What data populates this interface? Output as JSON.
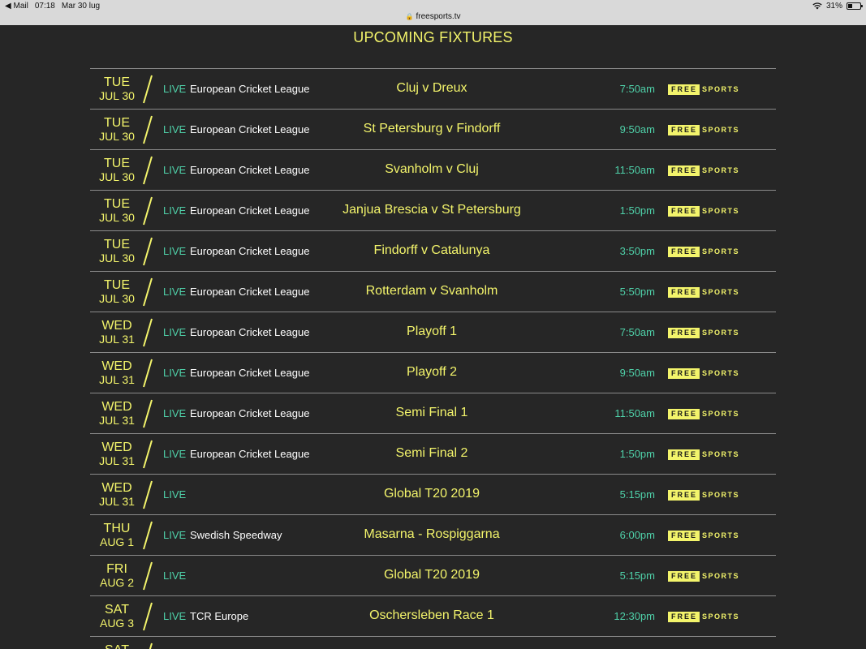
{
  "status_bar": {
    "back_app": "Mail",
    "time": "07:18",
    "date": "Mar 30 lug",
    "battery": "31%",
    "battery_level": 0.31,
    "url": "freesports.tv"
  },
  "page": {
    "title": "UPCOMING FIXTURES"
  },
  "fixtures": [
    {
      "day": "TUE",
      "date": "JUL 30",
      "live": "LIVE",
      "competition": "European Cricket League",
      "match": "Cluj v Dreux",
      "time": "7:50am",
      "channel_a": "FREE",
      "channel_b": "SPORTS"
    },
    {
      "day": "TUE",
      "date": "JUL 30",
      "live": "LIVE",
      "competition": "European Cricket League",
      "match": "St Petersburg v Findorff",
      "time": "9:50am",
      "channel_a": "FREE",
      "channel_b": "SPORTS"
    },
    {
      "day": "TUE",
      "date": "JUL 30",
      "live": "LIVE",
      "competition": "European Cricket League",
      "match": "Svanholm v Cluj",
      "time": "11:50am",
      "channel_a": "FREE",
      "channel_b": "SPORTS"
    },
    {
      "day": "TUE",
      "date": "JUL 30",
      "live": "LIVE",
      "competition": "European Cricket League",
      "match": "Janjua Brescia v St Petersburg",
      "time": "1:50pm",
      "channel_a": "FREE",
      "channel_b": "SPORTS"
    },
    {
      "day": "TUE",
      "date": "JUL 30",
      "live": "LIVE",
      "competition": "European Cricket League",
      "match": "Findorff v Catalunya",
      "time": "3:50pm",
      "channel_a": "FREE",
      "channel_b": "SPORTS"
    },
    {
      "day": "TUE",
      "date": "JUL 30",
      "live": "LIVE",
      "competition": "European Cricket League",
      "match": "Rotterdam v Svanholm",
      "time": "5:50pm",
      "channel_a": "FREE",
      "channel_b": "SPORTS"
    },
    {
      "day": "WED",
      "date": "JUL 31",
      "live": "LIVE",
      "competition": "European Cricket League",
      "match": "Playoff 1",
      "time": "7:50am",
      "channel_a": "FREE",
      "channel_b": "SPORTS"
    },
    {
      "day": "WED",
      "date": "JUL 31",
      "live": "LIVE",
      "competition": "European Cricket League",
      "match": "Playoff 2",
      "time": "9:50am",
      "channel_a": "FREE",
      "channel_b": "SPORTS"
    },
    {
      "day": "WED",
      "date": "JUL 31",
      "live": "LIVE",
      "competition": "European Cricket League",
      "match": "Semi Final 1",
      "time": "11:50am",
      "channel_a": "FREE",
      "channel_b": "SPORTS"
    },
    {
      "day": "WED",
      "date": "JUL 31",
      "live": "LIVE",
      "competition": "European Cricket League",
      "match": "Semi Final 2",
      "time": "1:50pm",
      "channel_a": "FREE",
      "channel_b": "SPORTS"
    },
    {
      "day": "WED",
      "date": "JUL 31",
      "live": "LIVE",
      "competition": "",
      "match": "Global T20 2019",
      "time": "5:15pm",
      "channel_a": "FREE",
      "channel_b": "SPORTS"
    },
    {
      "day": "THU",
      "date": "AUG 1",
      "live": "LIVE",
      "competition": "Swedish Speedway",
      "match": "Masarna - Rospiggarna",
      "time": "6:00pm",
      "channel_a": "FREE",
      "channel_b": "SPORTS"
    },
    {
      "day": "FRI",
      "date": "AUG 2",
      "live": "LIVE",
      "competition": "",
      "match": "Global T20 2019",
      "time": "5:15pm",
      "channel_a": "FREE",
      "channel_b": "SPORTS"
    },
    {
      "day": "SAT",
      "date": "AUG 3",
      "live": "LIVE",
      "competition": "TCR Europe",
      "match": "Oschersleben Race 1",
      "time": "12:30pm",
      "channel_a": "FREE",
      "channel_b": "SPORTS"
    },
    {
      "day": "SAT",
      "date": "",
      "live": "",
      "competition": "",
      "match": "",
      "time": "",
      "channel_a": "",
      "channel_b": ""
    }
  ]
}
